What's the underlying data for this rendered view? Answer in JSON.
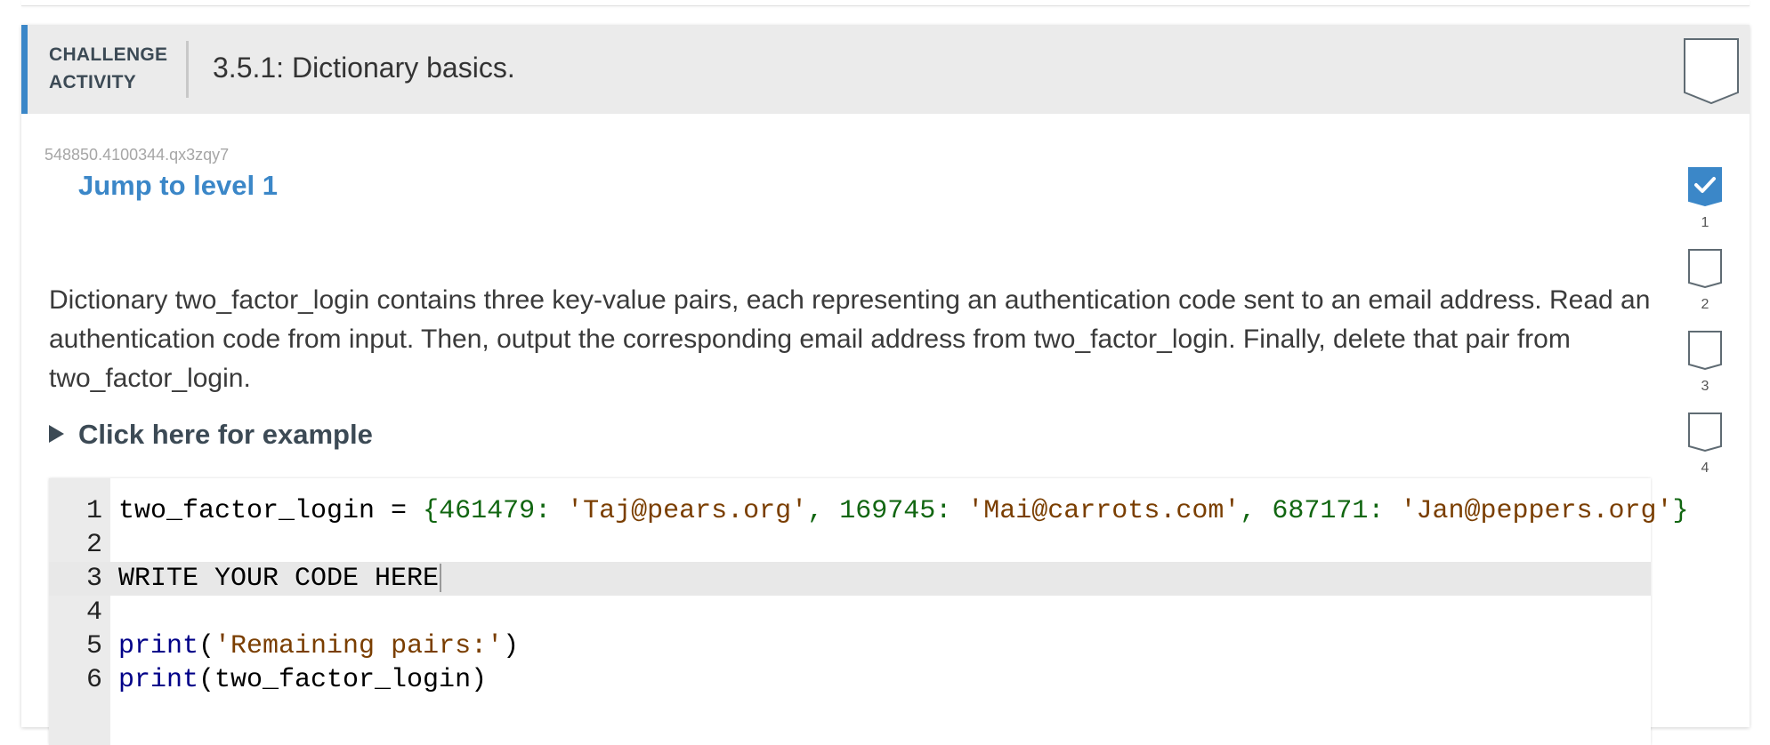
{
  "activity": {
    "label_line1": "CHALLENGE",
    "label_line2": "ACTIVITY",
    "title": "3.5.1: Dictionary basics.",
    "id": "548850.4100344.qx3zqy7",
    "jump_link": "Jump to level 1",
    "description": "Dictionary two_factor_login contains three key-value pairs, each representing an authentication code sent to an email address. Read an authentication code from input. Then, output the corresponding email address from two_factor_login. Finally, delete that pair from two_factor_login.",
    "example_toggle": "Click here for example"
  },
  "editor": {
    "lines": [
      {
        "num": "1",
        "code": "two_factor_login = {461479: 'Taj@pears.org', 169745: 'Mai@carrots.com', 687171: 'Jan@peppers.org'}"
      },
      {
        "num": "2",
        "code": ""
      },
      {
        "num": "3",
        "code": "WRITE YOUR CODE HERE"
      },
      {
        "num": "4",
        "code": ""
      },
      {
        "num": "5",
        "code": "print('Remaining pairs:')"
      },
      {
        "num": "6",
        "code": "print(two_factor_login)"
      }
    ],
    "active_line": 3
  },
  "levels": [
    {
      "label": "1",
      "completed": true
    },
    {
      "label": "2",
      "completed": false
    },
    {
      "label": "3",
      "completed": false
    },
    {
      "label": "4",
      "completed": false
    }
  ],
  "colors": {
    "accent": "#3b87c8",
    "header_bg": "#ebebeb",
    "keyword": "#000088",
    "string": "#7a3e00",
    "number": "#116611"
  }
}
